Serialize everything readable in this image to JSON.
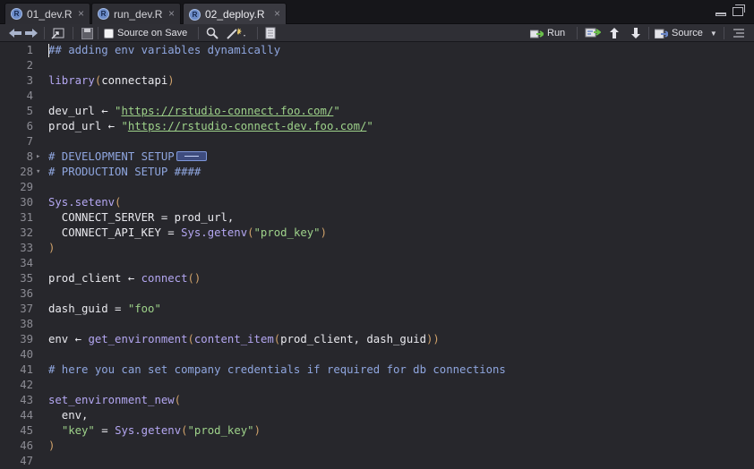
{
  "tabs": [
    {
      "name": "01_dev.R",
      "active": false
    },
    {
      "name": "run_dev.R",
      "active": false
    },
    {
      "name": "02_deploy.R",
      "active": true
    }
  ],
  "toolbar": {
    "source_on_save_label": "Source on Save",
    "run_label": "Run",
    "source_label": "Source"
  },
  "editor": {
    "lines": [
      {
        "num": "1",
        "tokens": [
          {
            "t": "## adding env variables dynamically",
            "c": "comment"
          }
        ]
      },
      {
        "num": "2",
        "tokens": []
      },
      {
        "num": "3",
        "tokens": [
          {
            "t": "library",
            "c": "fn"
          },
          {
            "t": "(",
            "c": "paren"
          },
          {
            "t": "connectapi",
            "c": "plain"
          },
          {
            "t": ")",
            "c": "paren"
          }
        ]
      },
      {
        "num": "4",
        "tokens": []
      },
      {
        "num": "5",
        "tokens": [
          {
            "t": "dev_url ",
            "c": "plain"
          },
          {
            "t": "←",
            "c": "op"
          },
          {
            "t": " \"",
            "c": "str"
          },
          {
            "t": "https://rstudio-connect.foo.com/",
            "c": "url"
          },
          {
            "t": "\"",
            "c": "str"
          }
        ]
      },
      {
        "num": "6",
        "tokens": [
          {
            "t": "prod_url ",
            "c": "plain"
          },
          {
            "t": "←",
            "c": "op"
          },
          {
            "t": " \"",
            "c": "str"
          },
          {
            "t": "https://rstudio-connect-dev.foo.com/",
            "c": "url"
          },
          {
            "t": "\"",
            "c": "str"
          }
        ]
      },
      {
        "num": "7",
        "tokens": []
      },
      {
        "num": "8",
        "fold": "▸",
        "tokens": [
          {
            "t": "# DEVELOPMENT SETUP",
            "c": "comment"
          }
        ],
        "folded": true
      },
      {
        "num": "28",
        "fold": "▾",
        "tokens": [
          {
            "t": "# PRODUCTION SETUP ####",
            "c": "comment"
          }
        ]
      },
      {
        "num": "29",
        "tokens": []
      },
      {
        "num": "30",
        "tokens": [
          {
            "t": "Sys.setenv",
            "c": "fn"
          },
          {
            "t": "(",
            "c": "paren"
          }
        ]
      },
      {
        "num": "31",
        "tokens": [
          {
            "t": "  CONNECT_SERVER = prod_url,",
            "c": "plain"
          }
        ]
      },
      {
        "num": "32",
        "tokens": [
          {
            "t": "  CONNECT_API_KEY = ",
            "c": "plain"
          },
          {
            "t": "Sys.getenv",
            "c": "fn"
          },
          {
            "t": "(",
            "c": "paren"
          },
          {
            "t": "\"prod_key\"",
            "c": "str"
          },
          {
            "t": ")",
            "c": "paren"
          }
        ]
      },
      {
        "num": "33",
        "tokens": [
          {
            "t": ")",
            "c": "paren"
          }
        ]
      },
      {
        "num": "34",
        "tokens": []
      },
      {
        "num": "35",
        "tokens": [
          {
            "t": "prod_client ",
            "c": "plain"
          },
          {
            "t": "←",
            "c": "op"
          },
          {
            "t": " ",
            "c": "plain"
          },
          {
            "t": "connect",
            "c": "fn"
          },
          {
            "t": "()",
            "c": "paren"
          }
        ]
      },
      {
        "num": "36",
        "tokens": []
      },
      {
        "num": "37",
        "tokens": [
          {
            "t": "dash_guid = ",
            "c": "plain"
          },
          {
            "t": "\"foo\"",
            "c": "str"
          }
        ]
      },
      {
        "num": "38",
        "tokens": []
      },
      {
        "num": "39",
        "tokens": [
          {
            "t": "env ",
            "c": "plain"
          },
          {
            "t": "←",
            "c": "op"
          },
          {
            "t": " ",
            "c": "plain"
          },
          {
            "t": "get_environment",
            "c": "fn"
          },
          {
            "t": "(",
            "c": "paren"
          },
          {
            "t": "content_item",
            "c": "fn"
          },
          {
            "t": "(",
            "c": "paren"
          },
          {
            "t": "prod_client, dash_guid",
            "c": "plain"
          },
          {
            "t": "))",
            "c": "paren"
          }
        ]
      },
      {
        "num": "40",
        "tokens": []
      },
      {
        "num": "41",
        "tokens": [
          {
            "t": "# here you can set company credentials if required for db connections",
            "c": "comment"
          }
        ]
      },
      {
        "num": "42",
        "tokens": []
      },
      {
        "num": "43",
        "tokens": [
          {
            "t": "set_environment_new",
            "c": "fn"
          },
          {
            "t": "(",
            "c": "paren"
          }
        ]
      },
      {
        "num": "44",
        "tokens": [
          {
            "t": "  env,",
            "c": "plain"
          }
        ]
      },
      {
        "num": "45",
        "tokens": [
          {
            "t": "  ",
            "c": "plain"
          },
          {
            "t": "\"key\"",
            "c": "str"
          },
          {
            "t": " = ",
            "c": "plain"
          },
          {
            "t": "Sys.getenv",
            "c": "fn"
          },
          {
            "t": "(",
            "c": "paren"
          },
          {
            "t": "\"prod_key\"",
            "c": "str"
          },
          {
            "t": ")",
            "c": "paren"
          }
        ]
      },
      {
        "num": "46",
        "tokens": [
          {
            "t": ")",
            "c": "paren"
          }
        ]
      },
      {
        "num": "47",
        "tokens": []
      }
    ]
  }
}
